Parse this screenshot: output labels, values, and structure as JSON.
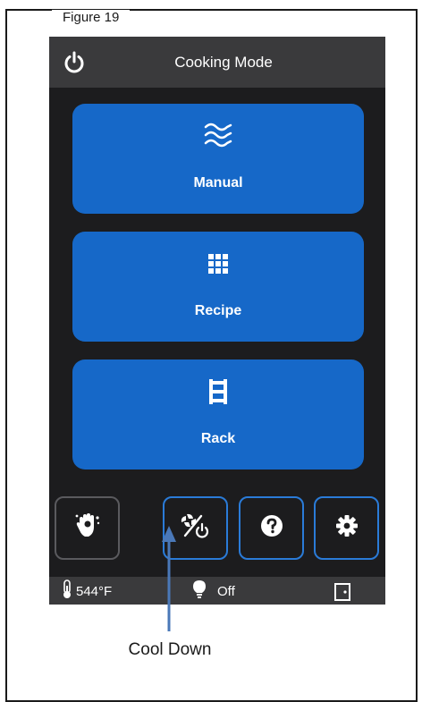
{
  "figure": {
    "caption": "Figure 19"
  },
  "header": {
    "title": "Cooking Mode",
    "power_icon": "power-icon"
  },
  "modes": [
    {
      "label": "Manual",
      "icon": "heat-waves-icon"
    },
    {
      "label": "Recipe",
      "icon": "grid-icon"
    },
    {
      "label": "Rack",
      "icon": "rack-icon"
    }
  ],
  "toolbar": {
    "buttons": [
      {
        "icon": "hand-cleaning-icon"
      },
      {
        "icon": "cool-down-fan-power-icon"
      },
      {
        "icon": "help-icon"
      },
      {
        "icon": "settings-gear-icon"
      }
    ]
  },
  "status": {
    "temperature": "544°F",
    "light": "Off",
    "thermometer_icon": "thermometer-icon",
    "light_icon": "lightbulb-icon",
    "door_icon": "door-icon"
  },
  "callout": {
    "label": "Cool Down"
  },
  "colors": {
    "screen_bg": "#1c1c1e",
    "bar_bg": "#3a3a3c",
    "button_blue": "#1668c8",
    "outline_blue": "#2a7bd8",
    "arrow_blue": "#4a78b8"
  }
}
